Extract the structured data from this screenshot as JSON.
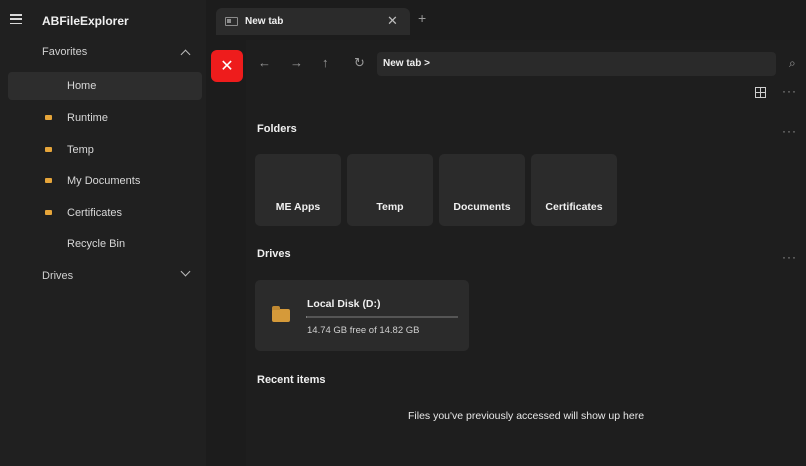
{
  "app": {
    "title": "ABFileExplorer"
  },
  "sidebar": {
    "favorites_label": "Favorites",
    "drives_label": "Drives",
    "items": [
      {
        "label": "Home",
        "folder": false,
        "active": true
      },
      {
        "label": "Runtime",
        "folder": true
      },
      {
        "label": "Temp",
        "folder": true
      },
      {
        "label": "My Documents",
        "folder": true
      },
      {
        "label": "Certificates",
        "folder": true
      },
      {
        "label": "Recycle Bin",
        "folder": false
      }
    ]
  },
  "tabs": [
    {
      "label": "New tab"
    }
  ],
  "toolbar": {
    "close_glyph": "✕",
    "back_glyph": "←",
    "forward_glyph": "→",
    "up_glyph": "↑",
    "refresh_glyph": "↻",
    "address": "New tab  >",
    "search_glyph": "⌕",
    "more_glyph": "···"
  },
  "sections": {
    "folders": "Folders",
    "drives": "Drives",
    "recent": "Recent items"
  },
  "folders": [
    "ME Apps",
    "Temp",
    "Documents",
    "Certificates"
  ],
  "drive": {
    "name": "Local Disk (D:)",
    "free_text": "14.74 GB free of 14.82 GB",
    "used_fraction": 0.005
  },
  "recent_empty": "Files you've previously accessed will show up here",
  "colors": {
    "accent_close": "#ee1c1c",
    "folder": "#e6a53a"
  }
}
